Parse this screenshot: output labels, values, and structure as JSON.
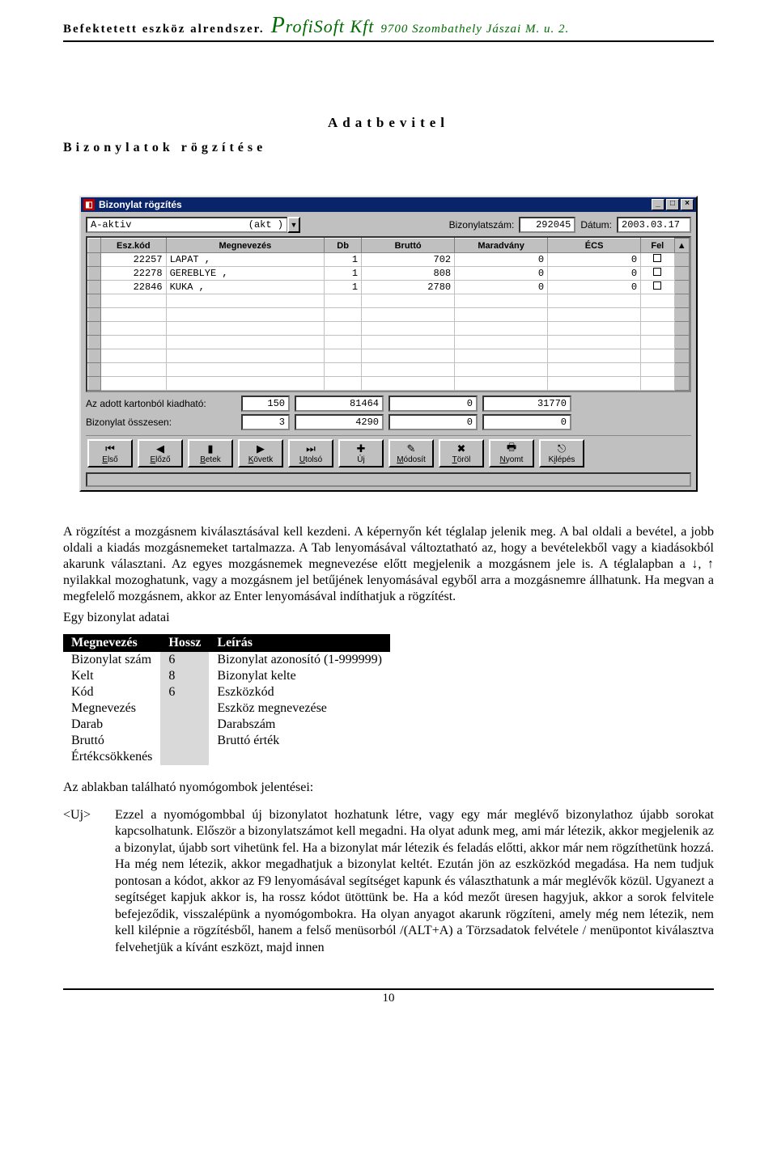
{
  "header": {
    "left": "Befektetett eszköz alrendszer.",
    "brand_prefix": "P",
    "brand_rest": "rofiSoft Kft",
    "right": "9700 Szombathely Jászai M. u. 2."
  },
  "titles": {
    "main": "Adatbevitel",
    "sub": "Bizonylatok rögzítése"
  },
  "win": {
    "title": "Bizonylat rögzítés",
    "combo_value": "A-aktiv",
    "combo_code": "(akt   )",
    "bsz_label": "Bizonylatszám:",
    "bsz_value": "292045",
    "date_label": "Dátum:",
    "date_value": "2003.03.17",
    "columns": [
      "Esz.kód",
      "Megnevezés",
      "Db",
      "Bruttó",
      "Maradvány",
      "ÉCS",
      "Fel"
    ],
    "rows": [
      {
        "kod": "22257",
        "meg": "LAPAT ,",
        "db": "1",
        "brutto": "702",
        "mar": "0",
        "ecs": "0",
        "fel": ""
      },
      {
        "kod": "22278",
        "meg": "GEREBLYE ,",
        "db": "1",
        "brutto": "808",
        "mar": "0",
        "ecs": "0",
        "fel": ""
      },
      {
        "kod": "22846",
        "meg": "KUKA ,",
        "db": "1",
        "brutto": "2780",
        "mar": "0",
        "ecs": "0",
        "fel": ""
      }
    ],
    "sum1_label": "Az adott kartonból kiadható:",
    "sum1": [
      "150",
      "81464",
      "0",
      "31770"
    ],
    "sum2_label": "Bizonylat összesen:",
    "sum2": [
      "3",
      "4290",
      "0",
      "0"
    ],
    "buttons": [
      {
        "icon": "⏮",
        "label": "Első",
        "u": "E"
      },
      {
        "icon": "◀",
        "label": "Előző",
        "u": "E"
      },
      {
        "icon": "▮",
        "label": "Betek",
        "u": "B"
      },
      {
        "icon": "▶",
        "label": "Követk",
        "u": "K"
      },
      {
        "icon": "⏭",
        "label": "Utolsó",
        "u": "U"
      },
      {
        "icon": "✚",
        "label": "Új",
        "u": "j"
      },
      {
        "icon": "✎",
        "label": "Módosít",
        "u": "M"
      },
      {
        "icon": "✖",
        "label": "Töröl",
        "u": "T"
      },
      {
        "icon": "🖶",
        "label": "Nyomt",
        "u": "N"
      },
      {
        "icon": "⎋",
        "label": "Kilépés",
        "u": "i"
      }
    ]
  },
  "para1": "A rögzítést a mozgásnem kiválasztásával kell kezdeni. A képernyőn két téglalap jelenik meg. A bal oldali a bevétel, a jobb oldali a kiadás mozgásnemeket tartalmazza. A Tab lenyomásával változtatható az, hogy a bevételekből vagy a kiadásokból akarunk választani. Az egyes mozgásnemek megnevezése előtt megjelenik a mozgásnem jele is. A téglalapban a ",
  "para1b": " nyilakkal mozoghatunk, vagy a mozgásnem jel betűjének lenyomásával egyből arra a mozgásnemre állhatunk. Ha megvan a megfelelő mozgásnem, akkor az Enter lenyomásával indíthatjuk a rögzítést.",
  "para2": "Egy bizonylat adatai",
  "desc": {
    "head": [
      "Megnevezés",
      "Hossz",
      "Leírás"
    ],
    "rows": [
      [
        "Bizonylat szám",
        "6",
        "Bizonylat azonosító (1-999999)"
      ],
      [
        "Kelt",
        "8",
        "Bizonylat kelte"
      ],
      [
        "Kód",
        "6",
        "Eszközkód"
      ],
      [
        "Megnevezés",
        "",
        "Eszköz megnevezése"
      ],
      [
        "Darab",
        "",
        "Darabszám"
      ],
      [
        "Bruttó",
        "",
        "Bruttó érték"
      ],
      [
        "Értékcsökkenés",
        "",
        ""
      ]
    ]
  },
  "para3": "Az ablakban található nyomógombok jelentései:",
  "uj_tag": "<Uj>",
  "uj_text": "Ezzel a nyomógombbal új bizonylatot hozhatunk létre, vagy egy már meglévő bizonylathoz újabb sorokat kapcsolhatunk. Először a bizonylatszámot kell megadni. Ha olyat adunk meg, ami már létezik, akkor megjelenik az a bizonylat, újabb sort vihetünk fel. Ha a bizonylat már létezik és feladás előtti, akkor már nem rögzíthetünk hozzá. Ha még nem létezik, akkor megadhatjuk a bizonylat keltét. Ezután jön az eszközkód megadása. Ha nem tudjuk pontosan a kódot, akkor az F9 lenyomásával segítséget kapunk és választhatunk a már meglévők közül. Ugyanezt a segítséget kapjuk akkor is, ha rossz kódot ütöttünk be. Ha a kód mezőt üresen hagyjuk, akkor a sorok felvitele befejeződik, visszalépünk a nyomógombokra. Ha olyan anyagot akarunk rögzíteni, amely még nem létezik, nem kell kilépnie a rögzítésből, hanem a felső menüsorból /(ALT+A) a Törzsadatok felvétele / menüpontot kiválasztva felvehetjük a kívánt eszközt, majd innen",
  "page_number": "10"
}
